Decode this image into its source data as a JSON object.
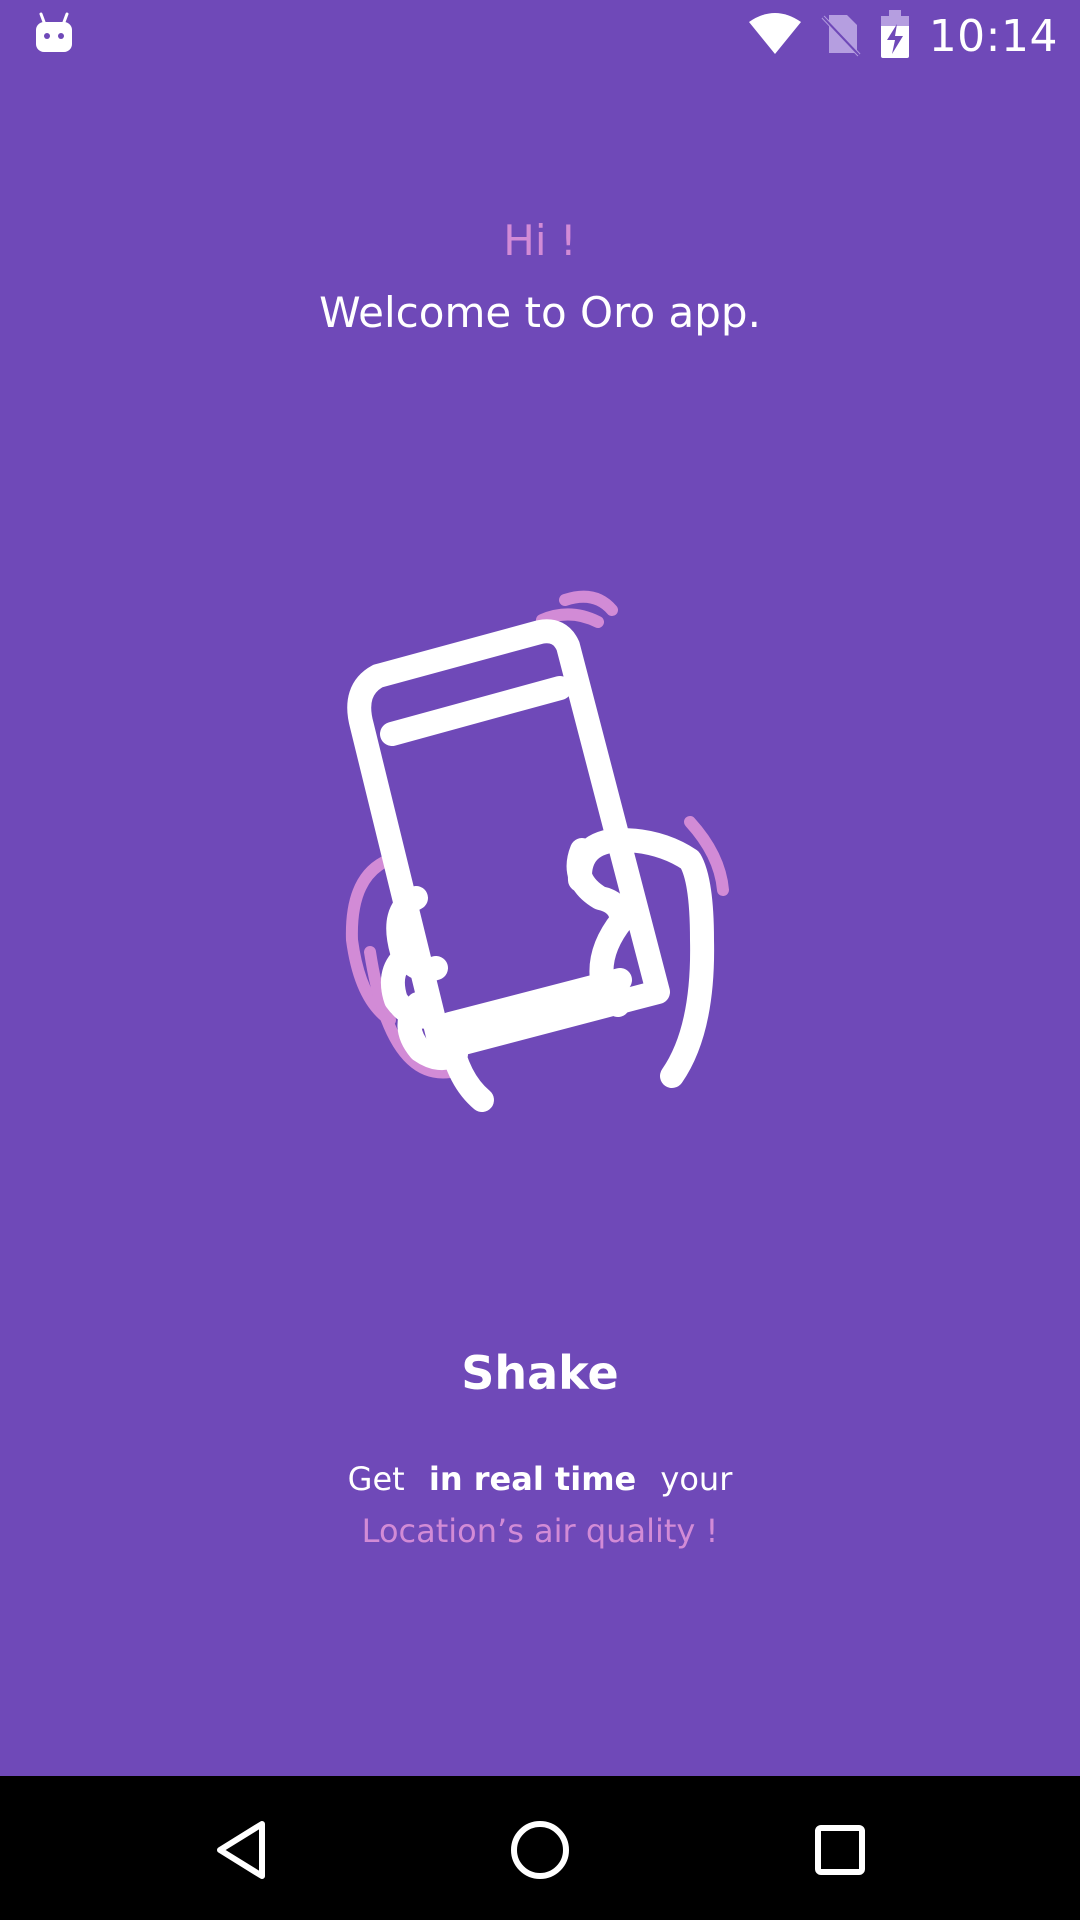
{
  "status_bar": {
    "time": "10:14",
    "icons": [
      "android-icon",
      "wifi-icon",
      "no-sim-icon",
      "battery-charging-icon"
    ]
  },
  "welcome": {
    "greeting": "Hi !",
    "message": "Welcome to Oro app."
  },
  "illustration": {
    "icon": "hand-shaking-phone-icon"
  },
  "feature": {
    "title": "Shake",
    "line1_pre": "Get",
    "line1_bold": "in real time",
    "line1_post": "your",
    "line2": "Location’s air quality !"
  },
  "nav_bar": {
    "buttons": [
      "back-icon",
      "home-icon",
      "recents-icon"
    ]
  },
  "colors": {
    "background": "#6f49b8",
    "accent": "#d28bd6",
    "text": "#ffffff"
  }
}
